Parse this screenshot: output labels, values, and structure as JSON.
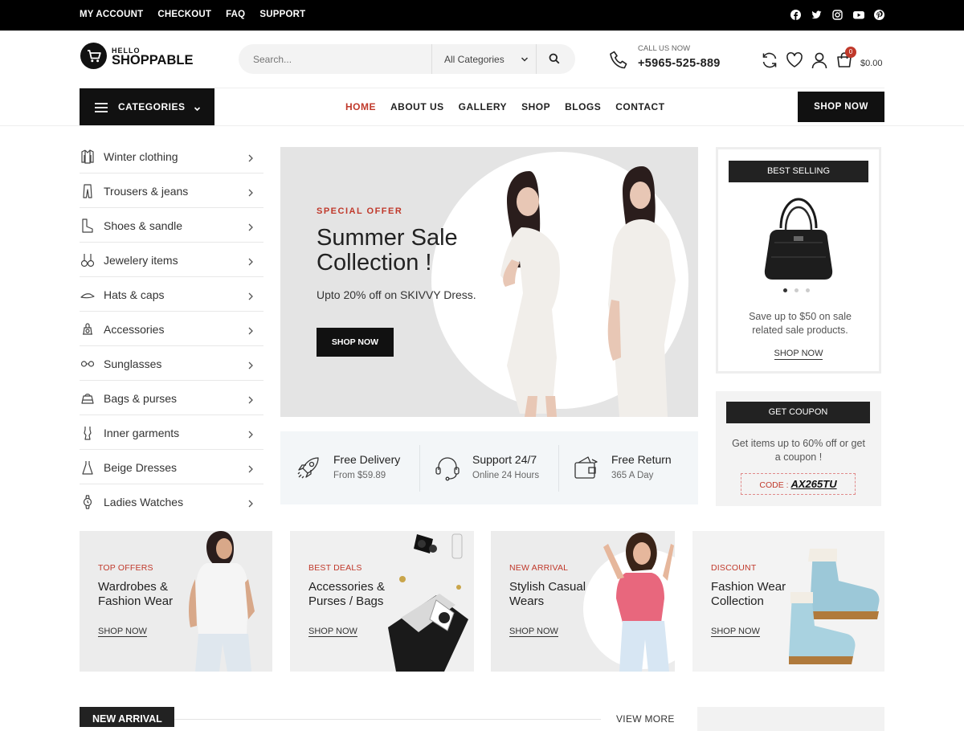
{
  "topbar": {
    "links": [
      "MY ACCOUNT",
      "CHECKOUT",
      "FAQ",
      "SUPPORT"
    ],
    "social_icons": [
      "facebook-icon",
      "twitter-icon",
      "instagram-icon",
      "youtube-icon",
      "pinterest-icon"
    ]
  },
  "header": {
    "logo_small": "HELLO",
    "logo_name": "SHOPPABLE",
    "search_placeholder": "Search...",
    "category_select": "All Categories",
    "call_label": "CALL US NOW",
    "call_number": "+5965-525-889",
    "cart_count": "0",
    "cart_total": "$0.00"
  },
  "nav": {
    "categories_label": "CATEGORIES",
    "links": [
      "HOME",
      "ABOUT US",
      "GALLERY",
      "SHOP",
      "BLOGS",
      "CONTACT"
    ],
    "active": "HOME",
    "shop_now": "SHOP NOW"
  },
  "sidebar": {
    "items": [
      {
        "label": "Winter clothing",
        "icon": "coat-icon"
      },
      {
        "label": "Trousers & jeans",
        "icon": "trousers-icon"
      },
      {
        "label": "Shoes & sandle",
        "icon": "boot-icon"
      },
      {
        "label": "Jewelery items",
        "icon": "earrings-icon"
      },
      {
        "label": "Hats & caps",
        "icon": "hat-icon"
      },
      {
        "label": "Accessories",
        "icon": "accessories-icon"
      },
      {
        "label": "Sunglasses",
        "icon": "sunglasses-icon"
      },
      {
        "label": "Bags & purses",
        "icon": "bag-icon"
      },
      {
        "label": "Inner garments",
        "icon": "garment-icon"
      },
      {
        "label": "Beige Dresses",
        "icon": "dress-icon"
      },
      {
        "label": "Ladies Watches",
        "icon": "watch-icon"
      }
    ]
  },
  "banner": {
    "tag": "SPECIAL OFFER",
    "title": "Summer Sale Collection !",
    "subtitle": "Upto 20% off on SKIVVY Dress.",
    "button": "SHOP NOW"
  },
  "features": [
    {
      "title": "Free Delivery",
      "sub": "From $59.89",
      "icon": "rocket-icon"
    },
    {
      "title": "Support 24/7",
      "sub": "Online 24 Hours",
      "icon": "headset-icon"
    },
    {
      "title": "Free Return",
      "sub": "365 A Day",
      "icon": "wallet-icon"
    }
  ],
  "best_selling": {
    "title": "BEST SELLING",
    "text": "Save up to $50 on sale related sale products.",
    "link": "SHOP NOW",
    "slide_active": 1,
    "slides": 3
  },
  "coupon": {
    "title": "GET COUPON",
    "text": "Get items up to 60% off or get a coupon !",
    "code_label": "CODE :",
    "code": "AX265TU"
  },
  "promos": [
    {
      "tag": "TOP OFFERS",
      "title": "Wardrobes & Fashion Wear",
      "link": "SHOP NOW"
    },
    {
      "tag": "BEST DEALS",
      "title": "Accessories & Purses / Bags",
      "link": "SHOP NOW"
    },
    {
      "tag": "NEW ARRIVAL",
      "title": "Stylish Casual Wears",
      "link": "SHOP NOW"
    },
    {
      "tag": "DISCOUNT",
      "title": "Fashion Wear Collection",
      "link": "SHOP NOW"
    }
  ],
  "new_arrival": {
    "title": "NEW ARRIVAL",
    "view_more": "VIEW MORE"
  },
  "colors": {
    "accent": "#c0392b",
    "dark": "#111111"
  }
}
